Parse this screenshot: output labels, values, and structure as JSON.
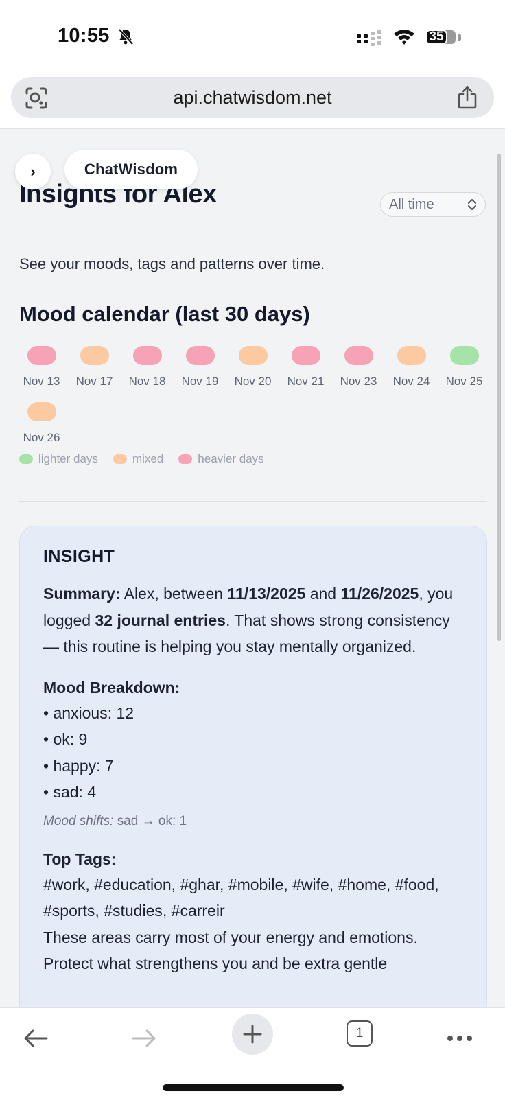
{
  "status_bar": {
    "time": "10:55",
    "battery": "35",
    "icons": [
      "bell-slash-icon",
      "signal-icon",
      "wifi-icon",
      "battery-icon"
    ]
  },
  "browser": {
    "url": "api.chatwisdom.net",
    "left_icon": "lens-icon",
    "right_icon": "share-icon"
  },
  "app": {
    "brand": "ChatWisdom",
    "toggle_label": "›"
  },
  "page": {
    "title": "Insights for Alex",
    "range_value": "All time",
    "subtitle": "See your moods, tags and patterns over time."
  },
  "calendar": {
    "title": "Mood calendar (last 30 days)",
    "days": [
      {
        "label": "Nov 13",
        "mood": "heavier"
      },
      {
        "label": "Nov 17",
        "mood": "mixed"
      },
      {
        "label": "Nov 18",
        "mood": "heavier"
      },
      {
        "label": "Nov 19",
        "mood": "heavier"
      },
      {
        "label": "Nov 20",
        "mood": "mixed"
      },
      {
        "label": "Nov 21",
        "mood": "heavier"
      },
      {
        "label": "Nov 23",
        "mood": "heavier"
      },
      {
        "label": "Nov 24",
        "mood": "mixed"
      },
      {
        "label": "Nov 25",
        "mood": "lighter"
      },
      {
        "label": "Nov 26",
        "mood": "mixed"
      }
    ],
    "legend": {
      "lighter": "lighter days",
      "mixed": "mixed",
      "heavier": "heavier days"
    },
    "colors": {
      "lighter": "#a6e3a9",
      "mixed": "#fcc9a1",
      "heavier": "#f5a3b5"
    }
  },
  "insight": {
    "heading": "INSIGHT",
    "summary": {
      "label": "Summary:",
      "t1": " Alex, between ",
      "d1": "11/13/2025",
      "t2": " and ",
      "d2": "11/26/2025",
      "t3": ", you logged ",
      "count": "32 journal entries",
      "t4": ". That shows strong consistency — this routine is helping you stay mentally organized."
    },
    "mood_breakdown_title": "Mood Breakdown:",
    "mood_breakdown": [
      "• anxious: 12",
      "• ok: 9",
      "• happy: 7",
      "• sad: 4"
    ],
    "shifts_label": "Mood shifts:",
    "shifts_value": " sad → ok: 1",
    "top_tags_title": "Top Tags:",
    "top_tags": "#work, #education, #ghar, #mobile, #wife, #home, #food, #sports, #studies, #carreir",
    "tags_note": "These areas carry most of your energy and emotions. Protect what strengthens you and be extra gentle"
  },
  "toolbar": {
    "tabs_count": "1"
  }
}
